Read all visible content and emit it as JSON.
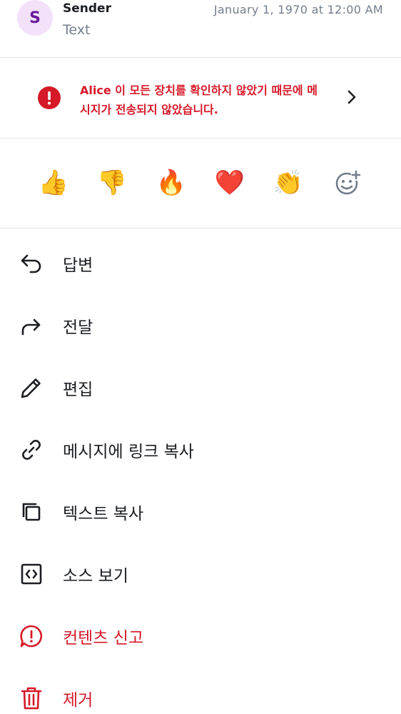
{
  "header": {
    "avatar_letter": "S",
    "sender": "Sender",
    "preview": "Text",
    "timestamp": "January 1, 1970 at 12:00 AM"
  },
  "warning": {
    "text": "Alice 이 모든 장치를 확인하지 않았기 때문에 메시지가 전송되지 않았습니다.",
    "icon": "alert-circle-icon",
    "color": "#d51928"
  },
  "reactions": [
    {
      "emoji": "👍",
      "name": "thumbs-up"
    },
    {
      "emoji": "👎",
      "name": "thumbs-down"
    },
    {
      "emoji": "🔥",
      "name": "fire"
    },
    {
      "emoji": "❤️",
      "name": "heart"
    },
    {
      "emoji": "👏",
      "name": "clap"
    }
  ],
  "reaction_add_icon": "emoji-add-icon",
  "menu": {
    "reply": "답변",
    "forward": "전달",
    "edit": "편집",
    "copy_link": "메시지에 링크 복사",
    "copy_text": "텍스트 복사",
    "view_source": "소스 보기",
    "report": "컨텐츠 신고",
    "remove": "제거"
  },
  "colors": {
    "danger": "#d51928",
    "secondary_text": "#737d8c",
    "avatar_bg": "#f3e1fa",
    "avatar_fg": "#6a1b9a"
  }
}
